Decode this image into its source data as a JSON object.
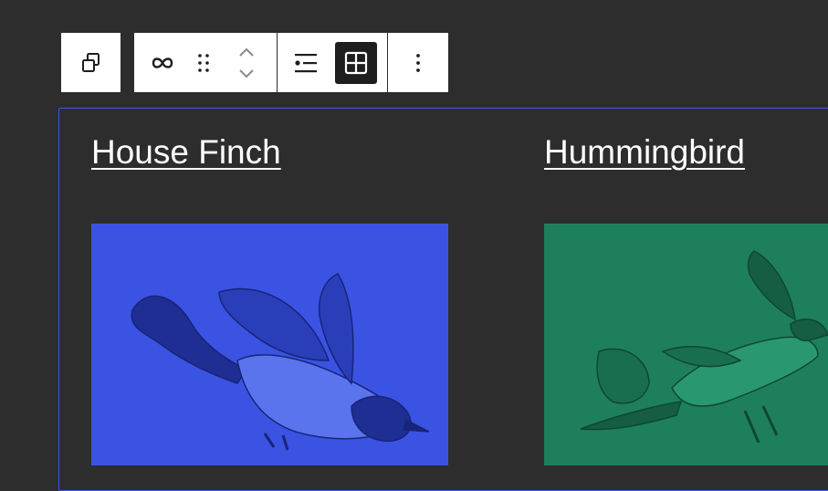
{
  "toolbar": {
    "transform_icon": "duplicate-blocks-icon",
    "link_icon": "link-icon",
    "drag_icon": "drag-handle-icon",
    "move_icon": "chevron-up-down-icon",
    "list_view_icon": "list-view-icon",
    "grid_view_icon": "grid-view-icon",
    "options_icon": "more-vertical-icon",
    "active_view": "grid"
  },
  "posts": [
    {
      "title": "House Finch",
      "image_color": "#3a53e3",
      "image_subject": "house-finch"
    },
    {
      "title": "Hummingbird",
      "image_color": "#1e7f5c",
      "image_subject": "hummingbird"
    }
  ],
  "colors": {
    "background": "#2d2d2d",
    "selection_border": "#3858e9",
    "toolbar_bg": "#ffffff",
    "active_tool_bg": "#1e1e1e"
  }
}
